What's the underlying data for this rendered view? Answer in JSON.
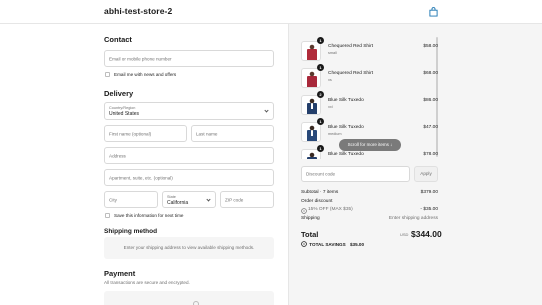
{
  "header": {
    "store_name": "abhi-test-store-2",
    "bag_icon": "shopping-bag-icon"
  },
  "contact": {
    "heading": "Contact",
    "email_placeholder": "Email or mobile phone number",
    "news_label": "Email me with news and offers"
  },
  "delivery": {
    "heading": "Delivery",
    "country_label": "Country/Region",
    "country_value": "United States",
    "first_name_placeholder": "First name (optional)",
    "last_name_placeholder": "Last name",
    "address_placeholder": "Address",
    "apartment_placeholder": "Apartment, suite, etc. (optional)",
    "city_placeholder": "City",
    "state_label": "State",
    "state_value": "California",
    "zip_placeholder": "ZIP code",
    "save_label": "Save this information for next time"
  },
  "shipping": {
    "heading": "Shipping method",
    "message": "Enter your shipping address to view available shipping methods."
  },
  "payment": {
    "heading": "Payment",
    "subtitle": "All transactions are secure and encrypted."
  },
  "cart": {
    "items": [
      {
        "name": "Chequered Red Shirt",
        "variant": "small",
        "qty": "1",
        "price": "$58.00",
        "image": "red-shirt"
      },
      {
        "name": "Chequered Red Shirt",
        "variant": "xs",
        "qty": "1",
        "price": "$68.00",
        "image": "red-shirt"
      },
      {
        "name": "Blue Silk Tuxedo",
        "variant": "xxl",
        "qty": "2",
        "price": "$86.00",
        "image": "tuxedo"
      },
      {
        "name": "Blue Silk Tuxedo",
        "variant": "medium",
        "qty": "1",
        "price": "$47.00",
        "image": "tuxedo"
      },
      {
        "name": "Blue Silk Tuxedo",
        "variant": "",
        "qty": "1",
        "price": "$78.00",
        "image": "tuxedo"
      }
    ],
    "scroll_hint": "Scroll for more items",
    "discount_placeholder": "Discount code",
    "apply_label": "Apply"
  },
  "summary": {
    "subtotal_label": "Subtotal · 7 items",
    "subtotal_value": "$379.00",
    "order_discount_label": "Order discount",
    "discount_name": "15% OFF (MAX $35)",
    "discount_value": "- $35.00",
    "shipping_label": "Shipping",
    "shipping_value": "Enter shipping address",
    "total_label": "Total",
    "currency": "USD",
    "total_value": "$344.00",
    "savings_label": "TOTAL SAVINGS",
    "savings_value": "$35.00"
  },
  "colors": {
    "panel_bg": "#f5f5f5",
    "text": "#1a1a1a",
    "muted": "#707070",
    "border": "#d9d9d9"
  }
}
